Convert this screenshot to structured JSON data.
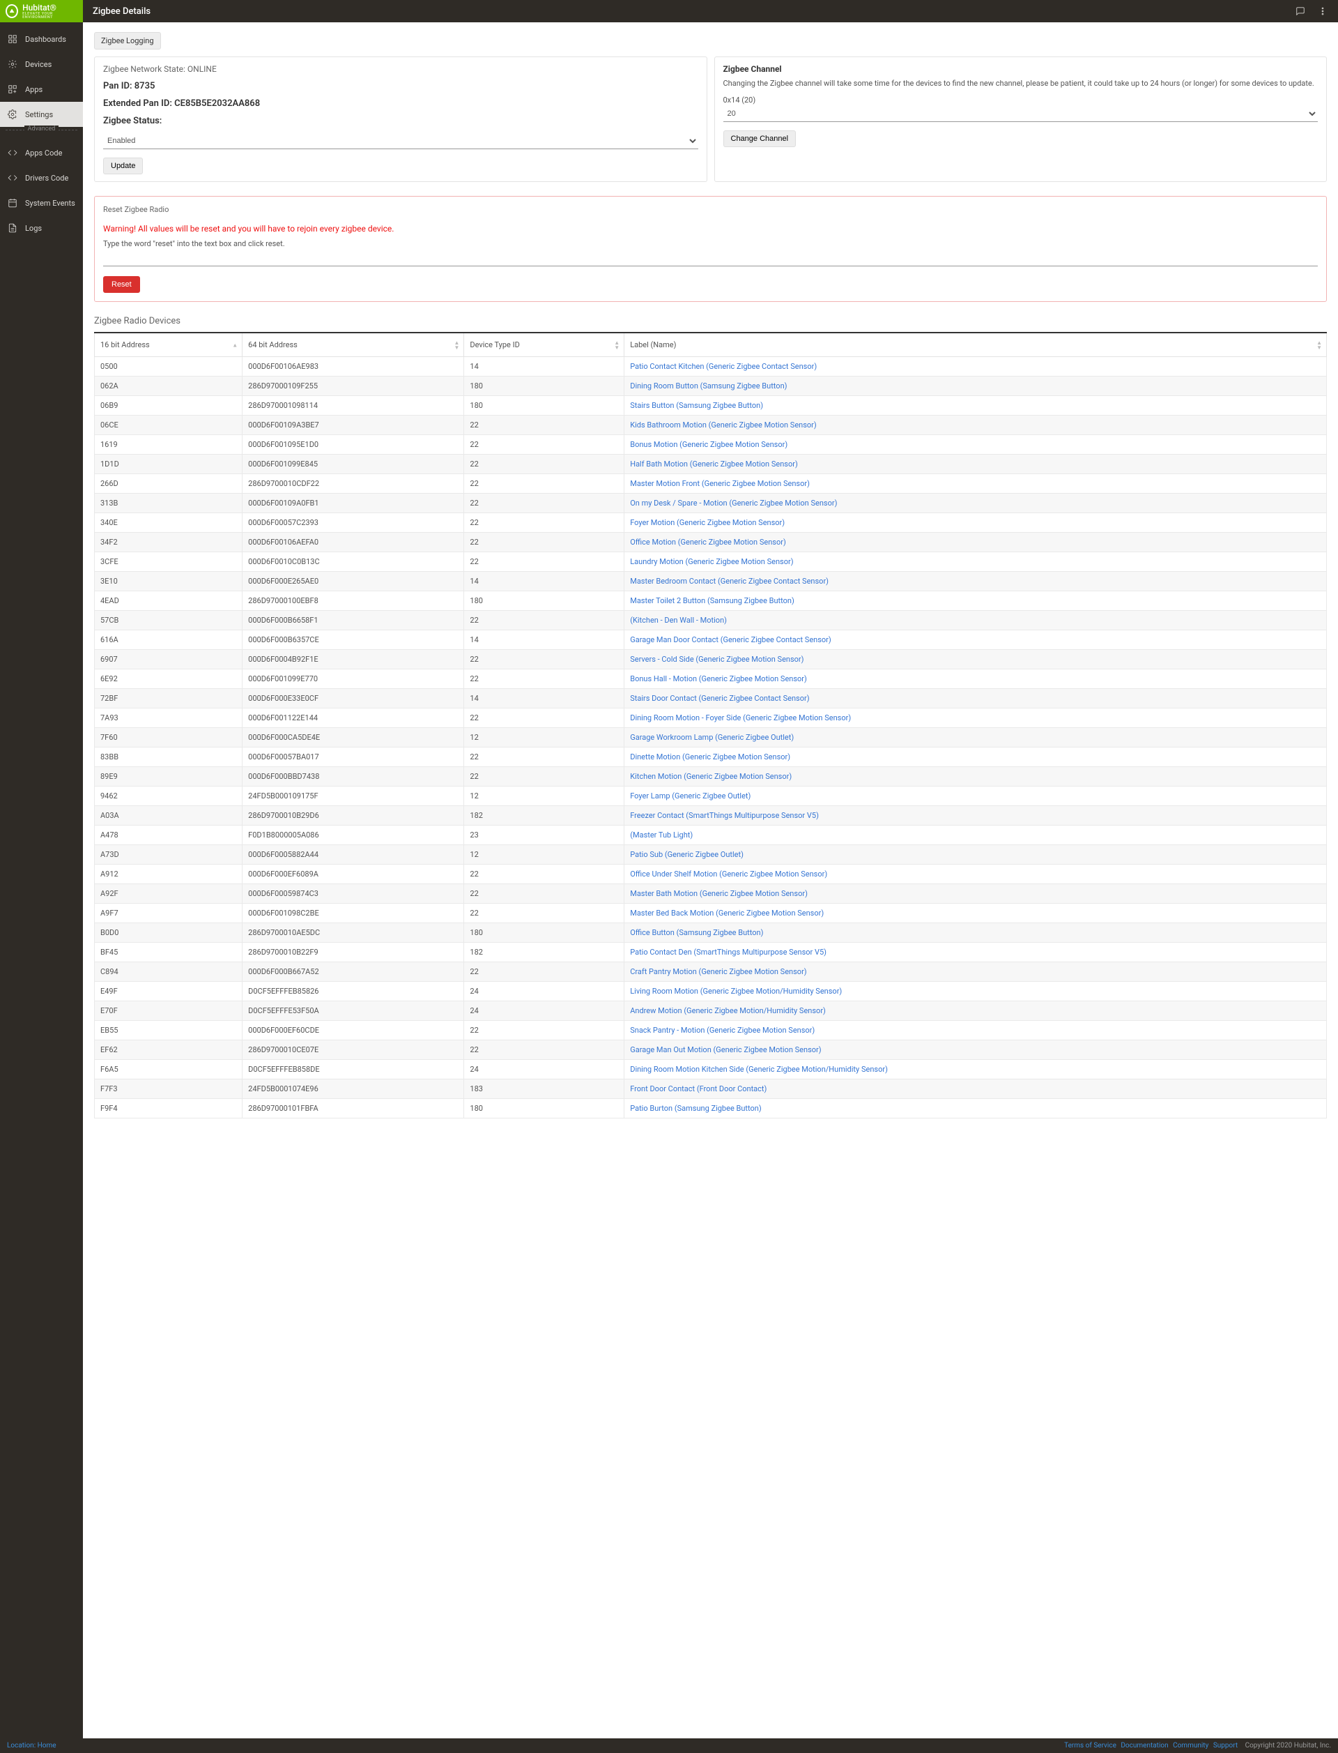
{
  "brand": {
    "name": "Hubitat",
    "tag": "ELEVATE YOUR ENVIRONMENT",
    "reg": "®"
  },
  "pageTitle": "Zigbee Details",
  "nav": {
    "dashboards": "Dashboards",
    "devices": "Devices",
    "apps": "Apps",
    "settings": "Settings",
    "advanced": "Advanced",
    "appsCode": "Apps Code",
    "driversCode": "Drivers Code",
    "systemEvents": "System Events",
    "logs": "Logs"
  },
  "loggingBtn": "Zigbee Logging",
  "status": {
    "stateLabel": "Zigbee Network State:",
    "state": "ONLINE",
    "panLabel": "Pan ID:",
    "pan": "8735",
    "extLabel": "Extended Pan ID:",
    "ext": "CE85B5E2032AA868",
    "zigStatusLabel": "Zigbee Status:",
    "enabled": "Enabled",
    "update": "Update"
  },
  "channel": {
    "title": "Zigbee Channel",
    "desc": "Changing the Zigbee channel will take some time for the devices to find the new channel, please be patient, it could take up to 24 hours (or longer) for some devices to update.",
    "hex": "0x14 (20)",
    "val": "20",
    "change": "Change Channel"
  },
  "reset": {
    "title": "Reset Zigbee Radio",
    "warn": "Warning! All values will be reset and you will have to rejoin every zigbee device.",
    "instr": "Type the word \"reset\" into the text box and click reset.",
    "btn": "Reset"
  },
  "table": {
    "title": "Zigbee Radio Devices",
    "cols": {
      "addr16": "16 bit Address",
      "addr64": "64 bit Address",
      "type": "Device Type ID",
      "label": "Label (Name)"
    },
    "rows": [
      {
        "a": "0500",
        "b": "000D6F00106AE983",
        "c": "14",
        "d": "Patio Contact Kitchen (Generic Zigbee Contact Sensor)"
      },
      {
        "a": "062A",
        "b": "286D97000109F255",
        "c": "180",
        "d": "Dining Room Button (Samsung Zigbee Button)"
      },
      {
        "a": "06B9",
        "b": "286D970001098114",
        "c": "180",
        "d": "Stairs Button (Samsung Zigbee Button)"
      },
      {
        "a": "06CE",
        "b": "000D6F00109A3BE7",
        "c": "22",
        "d": "Kids Bathroom Motion (Generic Zigbee Motion Sensor)"
      },
      {
        "a": "1619",
        "b": "000D6F001095E1D0",
        "c": "22",
        "d": "Bonus Motion (Generic Zigbee Motion Sensor)"
      },
      {
        "a": "1D1D",
        "b": "000D6F001099E845",
        "c": "22",
        "d": "Half Bath Motion (Generic Zigbee Motion Sensor)"
      },
      {
        "a": "266D",
        "b": "286D9700010CDF22",
        "c": "22",
        "d": "Master Motion Front (Generic Zigbee Motion Sensor)"
      },
      {
        "a": "313B",
        "b": "000D6F00109A0FB1",
        "c": "22",
        "d": "On my Desk / Spare - Motion (Generic Zigbee Motion Sensor)"
      },
      {
        "a": "340E",
        "b": "000D6F00057C2393",
        "c": "22",
        "d": "Foyer Motion (Generic Zigbee Motion Sensor)"
      },
      {
        "a": "34F2",
        "b": "000D6F00106AEFA0",
        "c": "22",
        "d": "Office Motion (Generic Zigbee Motion Sensor)"
      },
      {
        "a": "3CFE",
        "b": "000D6F0010C0B13C",
        "c": "22",
        "d": "Laundry Motion (Generic Zigbee Motion Sensor)"
      },
      {
        "a": "3E10",
        "b": "000D6F000E265AE0",
        "c": "14",
        "d": "Master Bedroom Contact (Generic Zigbee Contact Sensor)"
      },
      {
        "a": "4EAD",
        "b": "286D97000100EBF8",
        "c": "180",
        "d": "Master Toilet 2 Button (Samsung Zigbee Button)"
      },
      {
        "a": "57CB",
        "b": "000D6F000B6658F1",
        "c": "22",
        "d": "(Kitchen - Den Wall - Motion)"
      },
      {
        "a": "616A",
        "b": "000D6F000B6357CE",
        "c": "14",
        "d": "Garage Man Door Contact (Generic Zigbee Contact Sensor)"
      },
      {
        "a": "6907",
        "b": "000D6F0004B92F1E",
        "c": "22",
        "d": "Servers - Cold Side (Generic Zigbee Motion Sensor)"
      },
      {
        "a": "6E92",
        "b": "000D6F001099E770",
        "c": "22",
        "d": "Bonus Hall - Motion (Generic Zigbee Motion Sensor)"
      },
      {
        "a": "72BF",
        "b": "000D6F000E33E0CF",
        "c": "14",
        "d": "Stairs Door Contact (Generic Zigbee Contact Sensor)"
      },
      {
        "a": "7A93",
        "b": "000D6F001122E144",
        "c": "22",
        "d": "Dining Room Motion - Foyer Side (Generic Zigbee Motion Sensor)"
      },
      {
        "a": "7F60",
        "b": "000D6F000CA5DE4E",
        "c": "12",
        "d": "Garage Workroom Lamp (Generic Zigbee Outlet)"
      },
      {
        "a": "83BB",
        "b": "000D6F00057BA017",
        "c": "22",
        "d": "Dinette Motion (Generic Zigbee Motion Sensor)"
      },
      {
        "a": "89E9",
        "b": "000D6F000BBD7438",
        "c": "22",
        "d": "Kitchen Motion (Generic Zigbee Motion Sensor)"
      },
      {
        "a": "9462",
        "b": "24FD5B000109175F",
        "c": "12",
        "d": "Foyer Lamp (Generic Zigbee Outlet)"
      },
      {
        "a": "A03A",
        "b": "286D9700010B29D6",
        "c": "182",
        "d": "Freezer Contact (SmartThings Multipurpose Sensor V5)"
      },
      {
        "a": "A478",
        "b": "F0D1B8000005A086",
        "c": "23",
        "d": "(Master Tub Light)"
      },
      {
        "a": "A73D",
        "b": "000D6F0005882A44",
        "c": "12",
        "d": "Patio Sub (Generic Zigbee Outlet)"
      },
      {
        "a": "A912",
        "b": "000D6F000EF6089A",
        "c": "22",
        "d": "Office Under Shelf Motion (Generic Zigbee Motion Sensor)"
      },
      {
        "a": "A92F",
        "b": "000D6F00059874C3",
        "c": "22",
        "d": "Master Bath Motion (Generic Zigbee Motion Sensor)"
      },
      {
        "a": "A9F7",
        "b": "000D6F001098C2BE",
        "c": "22",
        "d": "Master Bed Back Motion (Generic Zigbee Motion Sensor)"
      },
      {
        "a": "B0D0",
        "b": "286D9700010AE5DC",
        "c": "180",
        "d": "Office Button (Samsung Zigbee Button)"
      },
      {
        "a": "BF45",
        "b": "286D9700010B22F9",
        "c": "182",
        "d": "Patio Contact Den (SmartThings Multipurpose Sensor V5)"
      },
      {
        "a": "C894",
        "b": "000D6F000B667A52",
        "c": "22",
        "d": "Craft Pantry Motion (Generic Zigbee Motion Sensor)"
      },
      {
        "a": "E49F",
        "b": "D0CF5EFFFEB85826",
        "c": "24",
        "d": "Living Room Motion (Generic Zigbee Motion/Humidity Sensor)"
      },
      {
        "a": "E70F",
        "b": "D0CF5EFFFE53F50A",
        "c": "24",
        "d": "Andrew Motion (Generic Zigbee Motion/Humidity Sensor)"
      },
      {
        "a": "EB55",
        "b": "000D6F000EF60CDE",
        "c": "22",
        "d": "Snack Pantry - Motion (Generic Zigbee Motion Sensor)"
      },
      {
        "a": "EF62",
        "b": "286D9700010CE07E",
        "c": "22",
        "d": "Garage Man Out Motion (Generic Zigbee Motion Sensor)"
      },
      {
        "a": "F6A5",
        "b": "D0CF5EFFFEB858DE",
        "c": "24",
        "d": "Dining Room Motion Kitchen Side (Generic Zigbee Motion/Humidity Sensor)"
      },
      {
        "a": "F7F3",
        "b": "24FD5B0001074E96",
        "c": "183",
        "d": "Front Door Contact (Front Door Contact)"
      },
      {
        "a": "F9F4",
        "b": "286D97000101FBFA",
        "c": "180",
        "d": "Patio Burton (Samsung Zigbee Button)"
      }
    ]
  },
  "footer": {
    "locLabel": "Location:",
    "loc": "Home",
    "tos": "Terms of Service",
    "docs": "Documentation",
    "community": "Community",
    "support": "Support",
    "copy": "Copyright 2020 Hubitat, Inc."
  }
}
